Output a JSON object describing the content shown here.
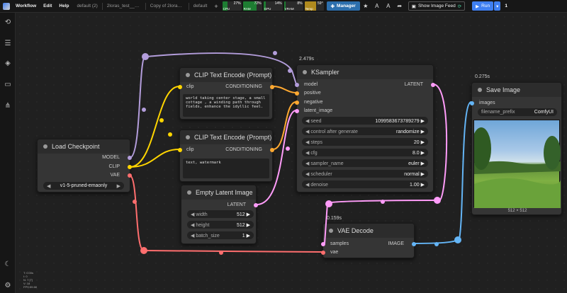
{
  "topbar": {
    "menus": [
      "Workflow",
      "Edit",
      "Help"
    ],
    "tabs": [
      "default (2)",
      "2loras_test__0104...",
      "Copy of 2loras_test_...",
      "default"
    ],
    "monitors": [
      {
        "label": "CPU",
        "value": "27%",
        "fill": 0.27,
        "color": "#1e7d32"
      },
      {
        "label": "RAM",
        "value": "72%",
        "fill": 0.72,
        "color": "#1e7d32"
      },
      {
        "label": "GPU",
        "value": "14%",
        "fill": 0.14,
        "color": "#1e7d32"
      },
      {
        "label": "VRAM",
        "value": "8%",
        "fill": 0.08,
        "color": "#1e7d32"
      },
      {
        "label": "Temp",
        "value": "59°",
        "fill": 0.59,
        "color": "#b08a1e"
      }
    ],
    "manager_label": "Manager",
    "feed_label": "Show Image Feed",
    "run_label": "Run",
    "queue_count": "1"
  },
  "stats": [
    "T: 0.00s",
    "I: 0",
    "N: 7 [7]",
    "V: 18",
    "FPS:59.68"
  ],
  "nodes": {
    "load_checkpoint": {
      "title": "Load Checkpoint",
      "out_model": "MODEL",
      "out_clip": "CLIP",
      "out_vae": "VAE",
      "ckpt": "v1-5-pruned-emaonly"
    },
    "clip1": {
      "title": "CLIP Text Encode (Prompt)",
      "in": "clip",
      "out": "CONDITIONING",
      "text": "world taking center stage, a small cottage , a winding path through fields, enhance the idyllic feel."
    },
    "clip2": {
      "title": "CLIP Text Encode (Prompt)",
      "in": "clip",
      "out": "CONDITIONING",
      "text": "text, watermark"
    },
    "empty_latent": {
      "title": "Empty Latent Image",
      "out": "LATENT",
      "width_label": "width",
      "width": "512",
      "height_label": "height",
      "height": "512",
      "batch_label": "batch_size",
      "batch": "1"
    },
    "ksampler": {
      "time": "2.479s",
      "title": "KSampler",
      "inputs": [
        "model",
        "positive",
        "negative",
        "latent_image"
      ],
      "out": "LATENT",
      "widgets": [
        {
          "label": "seed",
          "value": "1099583673789279"
        },
        {
          "label": "control after generate",
          "value": "randomize"
        },
        {
          "label": "steps",
          "value": "20"
        },
        {
          "label": "cfg",
          "value": "8.0"
        },
        {
          "label": "sampler_name",
          "value": "euler"
        },
        {
          "label": "scheduler",
          "value": "normal"
        },
        {
          "label": "denoise",
          "value": "1.00"
        }
      ]
    },
    "vae_decode": {
      "time": "0.159s",
      "title": "VAE Decode",
      "in_samples": "samples",
      "in_vae": "vae",
      "out": "IMAGE"
    },
    "save_image": {
      "time": "0.275s",
      "title": "Save Image",
      "in": "images",
      "prefix_label": "filename_prefix",
      "prefix": "ComfyUI",
      "size": "512 × 512"
    }
  }
}
